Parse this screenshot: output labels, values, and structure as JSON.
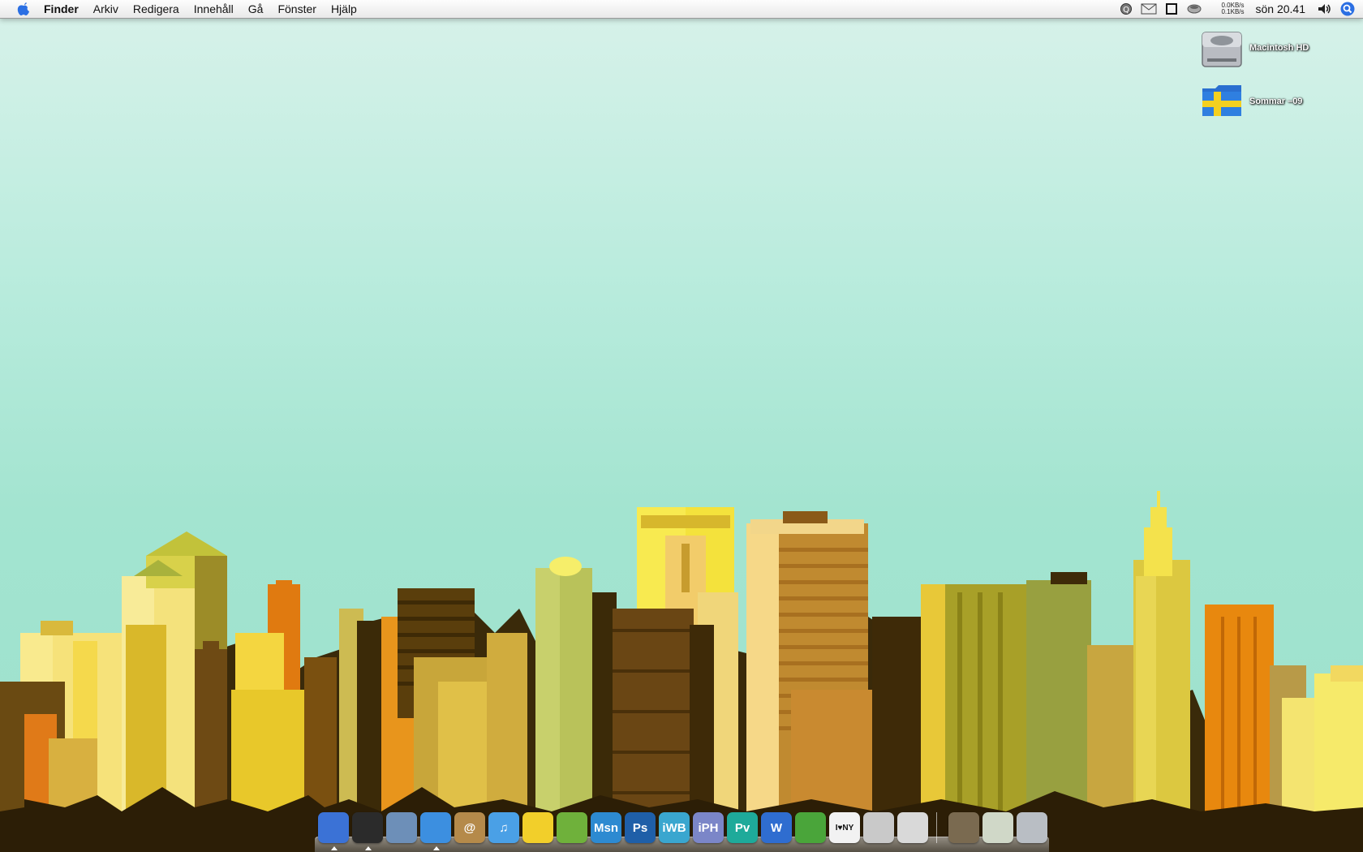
{
  "menubar": {
    "app_name": "Finder",
    "menus": [
      "Arkiv",
      "Redigera",
      "Innehåll",
      "Gå",
      "Fönster",
      "Hjälp"
    ],
    "net_down": "0.0KB/s",
    "net_up": "0.1KB/s",
    "clock": "sön 20.41",
    "status_icons": [
      "q-icon",
      "mail-icon",
      "window-icon",
      "cup-icon",
      "volume-icon",
      "spotlight-icon"
    ]
  },
  "desktop": {
    "icons": [
      {
        "label": "Macintosh HD",
        "icon": "hard-drive-icon"
      },
      {
        "label": "Sommar –09",
        "icon": "folder-sweden-icon"
      }
    ]
  },
  "dock": {
    "apps": [
      {
        "name": "finder",
        "text": "",
        "color": "#3b72d6",
        "running": true
      },
      {
        "name": "dashboard",
        "text": "",
        "color": "#2b2b2b",
        "running": true
      },
      {
        "name": "mail",
        "text": "",
        "color": "#6d8fb8",
        "running": false
      },
      {
        "name": "safari",
        "text": "",
        "color": "#3c8fe0",
        "running": true
      },
      {
        "name": "address-book",
        "text": "@",
        "color": "#b58a4a",
        "running": false
      },
      {
        "name": "itunes",
        "text": "♫",
        "color": "#4aa0e6",
        "running": false
      },
      {
        "name": "cyberduck",
        "text": "",
        "color": "#f2cf2a",
        "running": false
      },
      {
        "name": "spotify",
        "text": "",
        "color": "#6fb13b",
        "running": false
      },
      {
        "name": "msn",
        "text": "Msn",
        "color": "#2d8ad1",
        "running": false
      },
      {
        "name": "photoshop",
        "text": "Ps",
        "color": "#1f5fa8",
        "running": false
      },
      {
        "name": "iweb",
        "text": "iWB",
        "color": "#3aa6cf",
        "running": false
      },
      {
        "name": "iphoto",
        "text": "iPH",
        "color": "#7b86c8",
        "running": false
      },
      {
        "name": "preview",
        "text": "Pv",
        "color": "#1eaa9a",
        "running": false
      },
      {
        "name": "writer",
        "text": "W",
        "color": "#2f6dd0",
        "running": false
      },
      {
        "name": "limewire",
        "text": "",
        "color": "#4aa53a",
        "running": false
      },
      {
        "name": "iloveny",
        "text": "I♥NY",
        "color": "#f2f2f2",
        "running": false
      },
      {
        "name": "system-preferences",
        "text": "",
        "color": "#c9c9c9",
        "running": false
      },
      {
        "name": "apple-app",
        "text": "",
        "color": "#d9d9d9",
        "running": false
      }
    ],
    "stacks": [
      {
        "name": "broadcast",
        "color": "#7a6a50"
      },
      {
        "name": "downloads",
        "color": "#d0d8c8"
      },
      {
        "name": "trash",
        "color": "#b9bec4"
      }
    ]
  }
}
